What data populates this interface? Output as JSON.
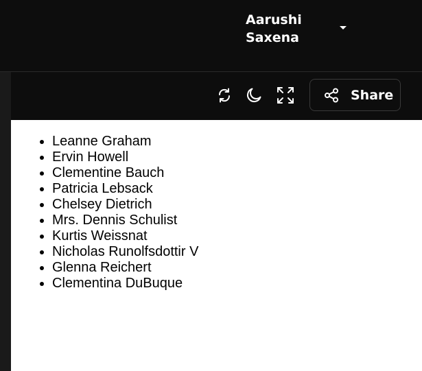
{
  "header": {
    "user": {
      "name_line1": "Aarushi",
      "name_line2": "Saxena",
      "menu_icon": "caret-down-icon"
    }
  },
  "toolbar": {
    "refresh_icon": "refresh-icon",
    "theme_icon": "moon-icon",
    "fullscreen_icon": "expand-icon",
    "share": {
      "icon": "share-icon",
      "label": "Share"
    }
  },
  "content": {
    "names": [
      "Leanne Graham",
      "Ervin Howell",
      "Clementine Bauch",
      "Patricia Lebsack",
      "Chelsey Dietrich",
      "Mrs. Dennis Schulist",
      "Kurtis Weissnat",
      "Nicholas Runolfsdottir V",
      "Glenna Reichert",
      "Clementina DuBuque"
    ]
  },
  "colors": {
    "chrome_bg": "#0d0d0d",
    "content_bg": "#ffffff",
    "text_light": "#ffffff",
    "border": "#3a3a3a"
  }
}
